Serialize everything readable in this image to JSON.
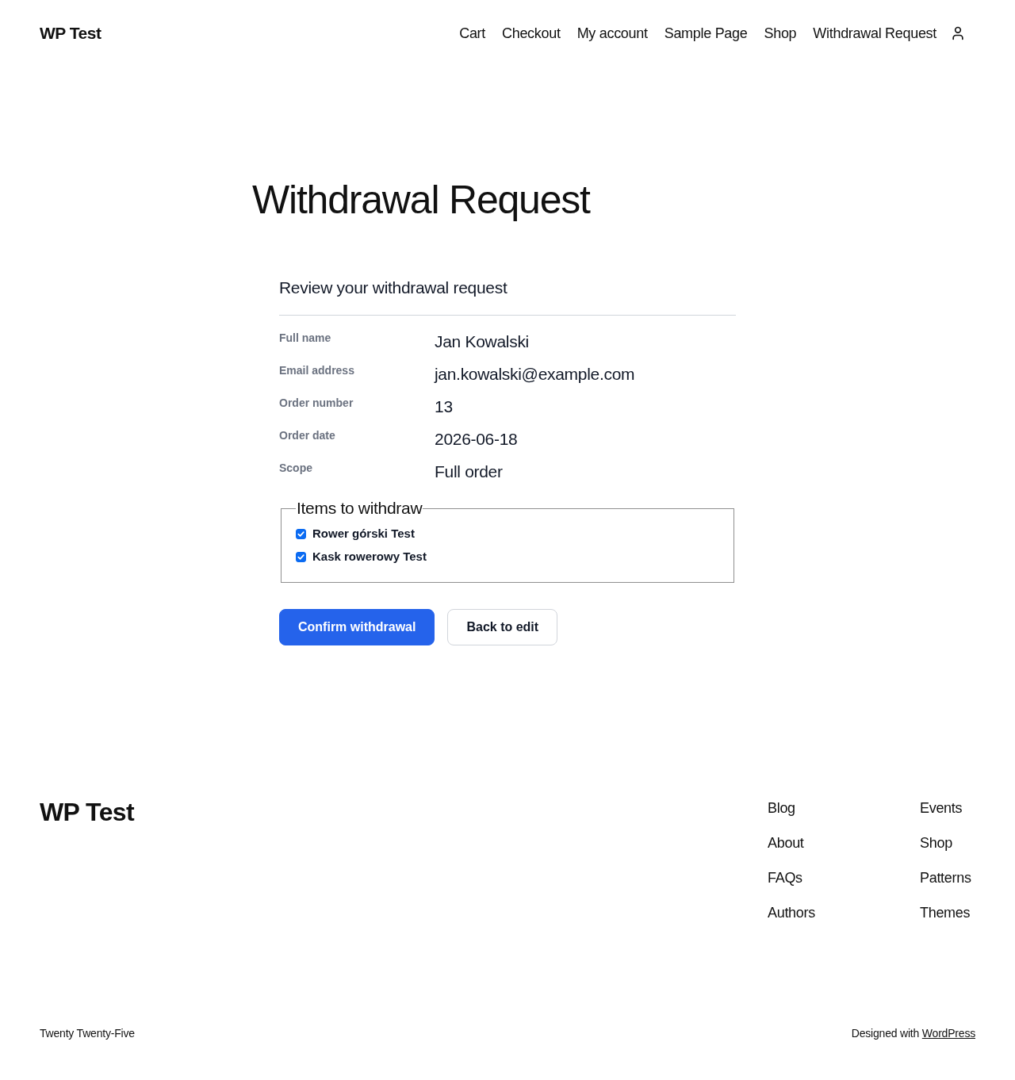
{
  "header": {
    "site_title": "WP Test",
    "nav": [
      "Cart",
      "Checkout",
      "My account",
      "Sample Page",
      "Shop",
      "Withdrawal Request"
    ]
  },
  "page_title": "Withdrawal Request",
  "review": {
    "heading": "Review your withdrawal request",
    "fields": [
      {
        "label": "Full name",
        "value": "Jan Kowalski"
      },
      {
        "label": "Email address",
        "value": "jan.kowalski@example.com"
      },
      {
        "label": "Order number",
        "value": "13"
      },
      {
        "label": "Order date",
        "value": "2026-06-18"
      },
      {
        "label": "Scope",
        "value": "Full order"
      }
    ]
  },
  "items_fieldset": {
    "legend": "Items to withdraw",
    "items": [
      {
        "label": "Rower górski Test",
        "checked": true
      },
      {
        "label": "Kask rowerowy Test",
        "checked": true
      }
    ]
  },
  "buttons": [
    {
      "label": "Confirm withdrawal",
      "kind": "primary"
    },
    {
      "label": "Back to edit",
      "kind": "secondary"
    }
  ],
  "footer": {
    "site_title": "WP Test",
    "link_columns": [
      [
        "Blog",
        "About",
        "FAQs",
        "Authors"
      ],
      [
        "Events",
        "Shop",
        "Patterns",
        "Themes"
      ]
    ],
    "theme_credit": "Twenty Twenty-Five",
    "designed_with": "Designed with",
    "designed_with_link": "WordPress"
  }
}
